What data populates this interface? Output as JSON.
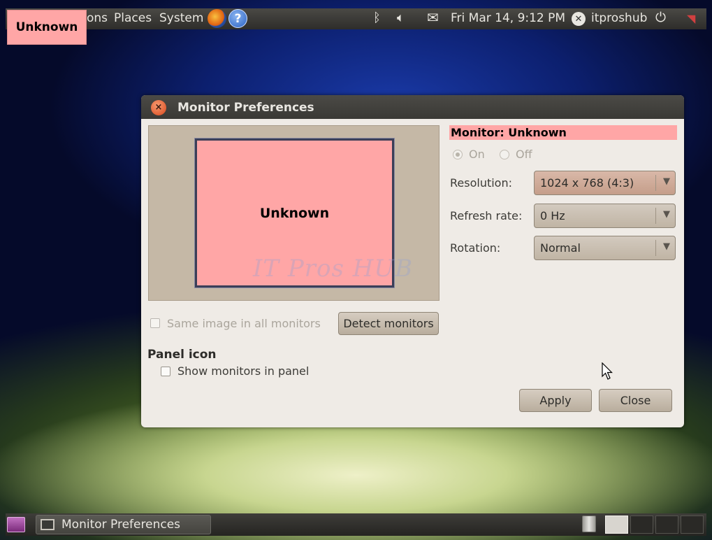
{
  "top_panel": {
    "menus": [
      "ons",
      "Places",
      "System"
    ],
    "clock": "Fri Mar 14,  9:12 PM",
    "user": "itproshub"
  },
  "overlay_tag": "Unknown",
  "dialog": {
    "title": "Monitor Preferences",
    "preview_label": "Unknown",
    "watermark": "IT Pros HUB",
    "monitor_header": "Monitor: Unknown",
    "on_label": "On",
    "off_label": "Off",
    "resolution_label": "Resolution:",
    "resolution_value": "1024 x 768 (4:3)",
    "refresh_label": "Refresh rate:",
    "refresh_value": "0 Hz",
    "rotation_label": "Rotation:",
    "rotation_value": "Normal",
    "same_image_label": "Same image in all monitors",
    "detect_button": "Detect monitors",
    "panel_icon_heading": "Panel icon",
    "show_monitors_label": "Show monitors in panel",
    "apply_button": "Apply",
    "close_button": "Close"
  },
  "bottom_panel": {
    "task_label": "Monitor Preferences"
  }
}
